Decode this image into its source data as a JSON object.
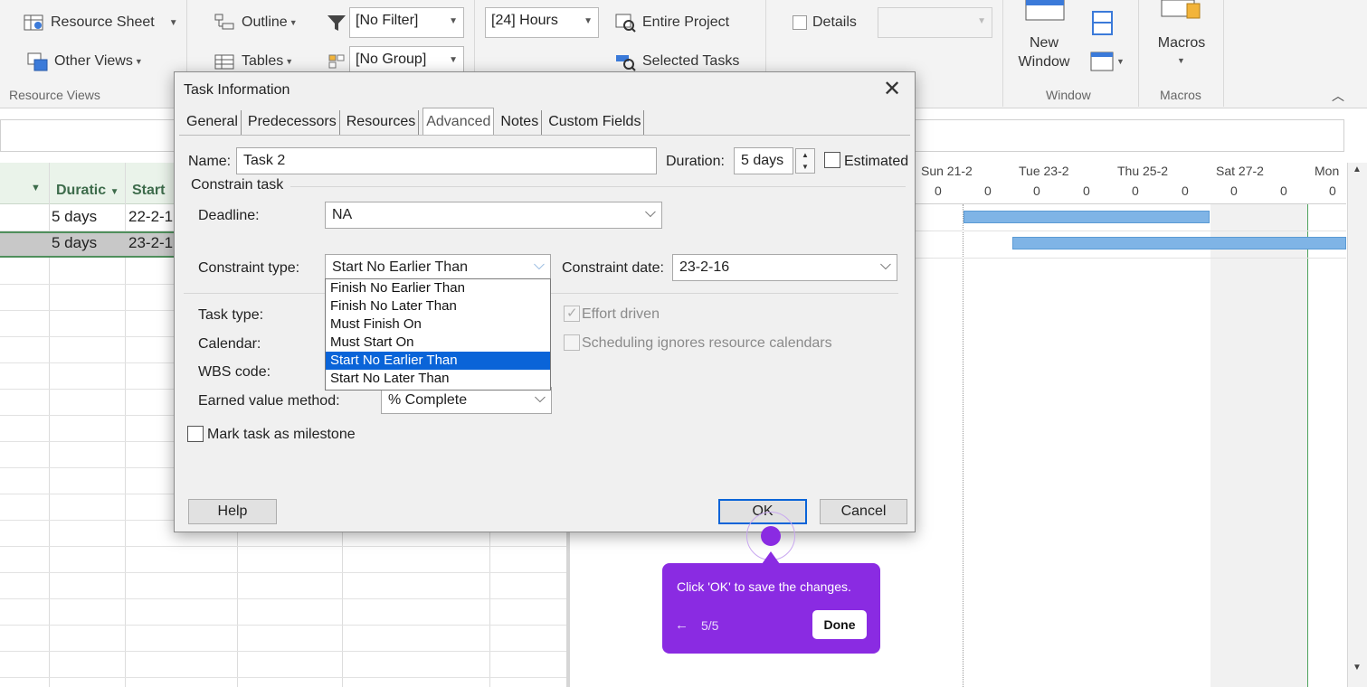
{
  "ribbon": {
    "resource_sheet": "Resource Sheet",
    "other_views": "Other Views",
    "resource_views_group": "Resource Views",
    "outline": "Outline",
    "tables": "Tables",
    "filter_value": "[No Filter]",
    "group_value": "[No Group]",
    "timescale_value": "[24] Hours",
    "entire_project": "Entire Project",
    "selected_tasks": "Selected Tasks",
    "details": "Details",
    "new_window": "New Window",
    "macros": "Macros",
    "window_group": "Window",
    "macros_group": "Macros"
  },
  "table": {
    "columns": [
      "Duratic",
      "Start"
    ],
    "rows": [
      {
        "duration": "5 days",
        "start": "22-2-1"
      },
      {
        "duration": "5 days",
        "start": "23-2-1"
      }
    ]
  },
  "gantt": {
    "days": [
      "Sun 21-2",
      "Tue 23-2",
      "Thu 25-2",
      "Sat 27-2",
      "Mon"
    ],
    "tick": "0"
  },
  "dialog": {
    "title": "Task Information",
    "tabs": [
      "General",
      "Predecessors",
      "Resources",
      "Advanced",
      "Notes",
      "Custom Fields"
    ],
    "name_label": "Name:",
    "name_value": "Task 2",
    "duration_label": "Duration:",
    "duration_value": "5 days",
    "estimated_label": "Estimated",
    "constrain_task": "Constrain task",
    "deadline_label": "Deadline:",
    "deadline_value": "NA",
    "constraint_type_label": "Constraint type:",
    "constraint_type_value": "Start No Earlier Than",
    "constraint_date_label": "Constraint date:",
    "constraint_date_value": "23-2-16",
    "constraint_options": [
      "Finish No Earlier Than",
      "Finish No Later Than",
      "Must Finish On",
      "Must Start On",
      "Start No Earlier Than",
      "Start No Later Than"
    ],
    "selected_option": "Start No Earlier Than",
    "task_type_label": "Task type:",
    "calendar_label": "Calendar:",
    "wbs_label": "WBS code:",
    "effort_driven": "Effort driven",
    "scheduling_ignores": "Scheduling ignores resource calendars",
    "earned_value_label": "Earned value method:",
    "earned_value_value": "% Complete",
    "milestone_label": "Mark task as milestone",
    "help": "Help",
    "ok": "OK",
    "cancel": "Cancel"
  },
  "guide": {
    "text": "Click 'OK' to save the changes.",
    "step": "5/5",
    "done": "Done",
    "back_icon": "←"
  },
  "colors": {
    "accent": "#8a2be2",
    "selection": "#0a64d8",
    "gantt_bar": "#7fb4e6",
    "table_header": "#3d6b4b"
  }
}
